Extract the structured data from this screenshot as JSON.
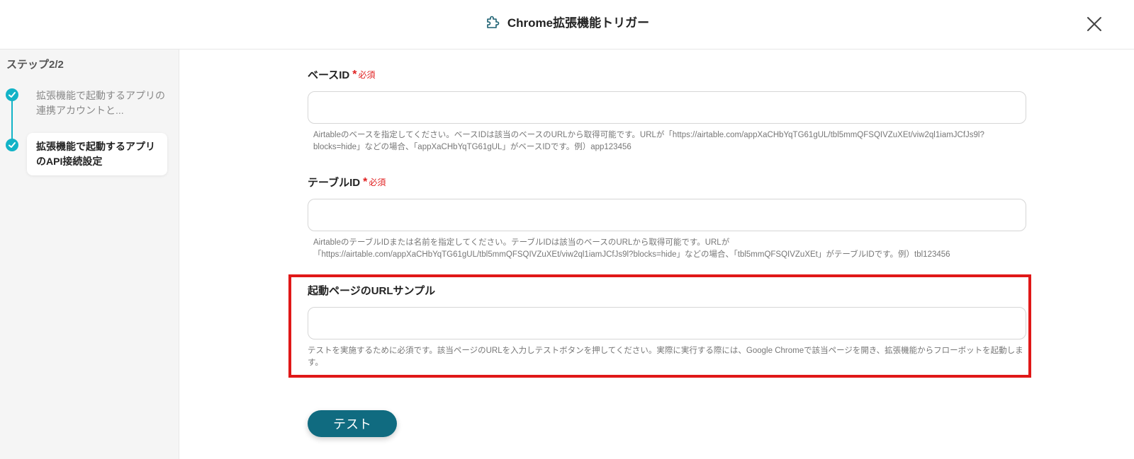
{
  "header": {
    "title": "Chrome拡張機能トリガー",
    "icon": "puzzle-icon",
    "close_icon": "close-icon"
  },
  "sidebar": {
    "step_count": "ステップ2/2",
    "steps": [
      {
        "label": "拡張機能で起動するアプリの連携アカウントと...",
        "status": "completed"
      },
      {
        "label": "拡張機能で起動するアプリのAPI接続設定",
        "status": "current"
      }
    ]
  },
  "form": {
    "base_id": {
      "label": "ベースID",
      "required_star": "*",
      "required_text": "必須",
      "value": "",
      "help": "Airtableのベースを指定してください。ベースIDは該当のベースのURLから取得可能です。URLが「https://airtable.com/appXaCHbYqTG61gUL/tbl5mmQFSQIVZuXEt/viw2ql1iamJCfJs9l?blocks=hide」などの場合、「appXaCHbYqTG61gUL」がベースIDです。例）app123456"
    },
    "table_id": {
      "label": "テーブルID",
      "required_star": "*",
      "required_text": "必須",
      "value": "",
      "help": "AirtableのテーブルIDまたは名前を指定してください。テーブルIDは該当のベースのURLから取得可能です。URLが「https://airtable.com/appXaCHbYqTG61gUL/tbl5mmQFSQIVZuXEt/viw2ql1iamJCfJs9l?blocks=hide」などの場合、「tbl5mmQFSQIVZuXEt」がテーブルIDです。例）tbl123456"
    },
    "url_sample": {
      "label": "起動ページのURLサンプル",
      "value": "",
      "help": "テストを実施するために必須です。該当ページのURLを入力しテストボタンを押してください。実際に実行する際には、Google Chromeで該当ページを開き、拡張機能からフローボットを起動します。"
    }
  },
  "test_button_label": "テスト",
  "colors": {
    "accent": "#12b3c7",
    "button": "#106b80",
    "required": "#e02020",
    "highlight": "#e01818"
  }
}
